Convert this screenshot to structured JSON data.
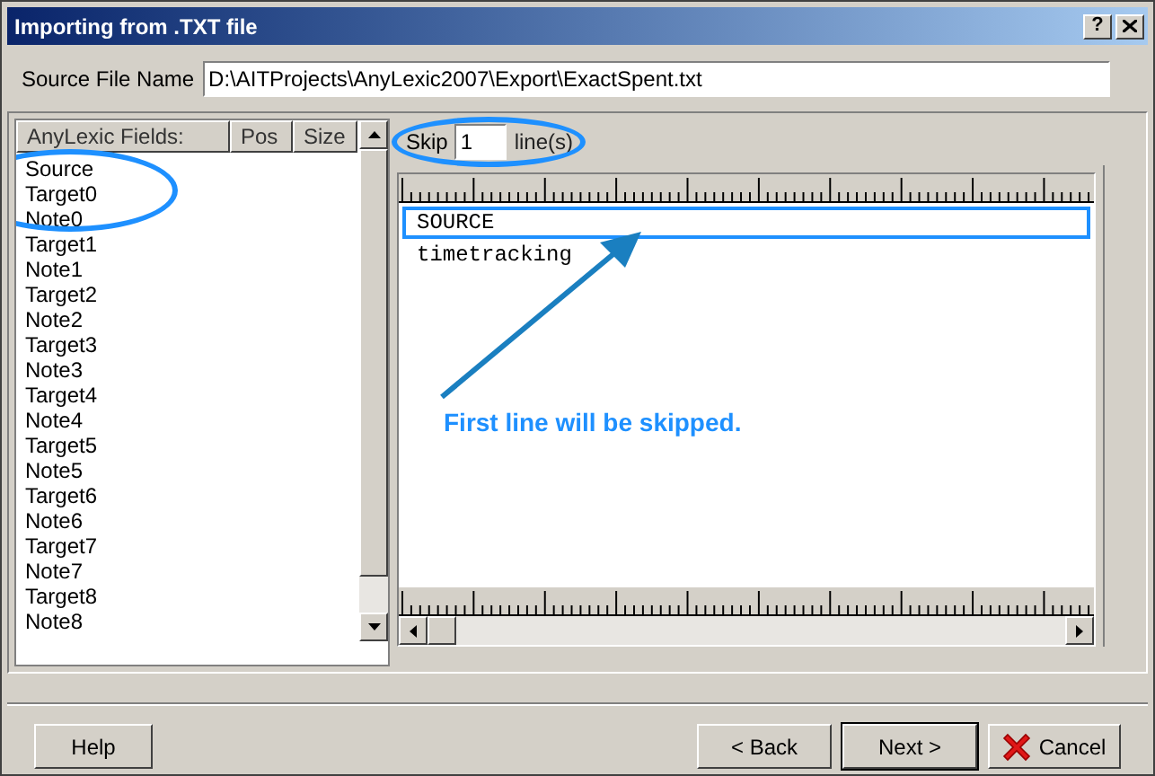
{
  "window": {
    "title": "Importing from .TXT file",
    "help_glyph": "?"
  },
  "source_file": {
    "label": "Source File Name",
    "value": "D:\\AITProjects\\AnyLexic2007\\Export\\ExactSpent.txt"
  },
  "fields": {
    "columns": [
      "AnyLexic Fields:",
      "Pos",
      "Size"
    ],
    "items": [
      {
        "name": "Source",
        "circled": true
      },
      {
        "name": "Target0",
        "circled": true
      },
      {
        "name": "Note0",
        "circled": true
      },
      {
        "name": "Target1",
        "circled": false
      },
      {
        "name": "Note1",
        "circled": false
      },
      {
        "name": "Target2",
        "circled": false
      },
      {
        "name": "Note2",
        "circled": false
      },
      {
        "name": "Target3",
        "circled": false
      },
      {
        "name": "Note3",
        "circled": false
      },
      {
        "name": "Target4",
        "circled": false
      },
      {
        "name": "Note4",
        "circled": false
      },
      {
        "name": "Target5",
        "circled": false
      },
      {
        "name": "Note5",
        "circled": false
      },
      {
        "name": "Target6",
        "circled": false
      },
      {
        "name": "Note6",
        "circled": false
      },
      {
        "name": "Target7",
        "circled": false
      },
      {
        "name": "Note7",
        "circled": false
      },
      {
        "name": "Target8",
        "circled": false
      },
      {
        "name": "Note8",
        "circled": false
      }
    ]
  },
  "skip": {
    "label": "Skip",
    "value": "1",
    "unit": "line(s)",
    "circled": true
  },
  "preview": {
    "lines": [
      {
        "text": "SOURCE",
        "highlighted": true
      },
      {
        "text": "timetracking",
        "highlighted": false
      }
    ],
    "callout": "First line will be skipped."
  },
  "buttons": [
    {
      "label": "Help",
      "kind": "help"
    },
    {
      "label": "< Back",
      "kind": "back"
    },
    {
      "label": "Next >",
      "kind": "default"
    },
    {
      "label": "Cancel",
      "kind": "cancel"
    }
  ]
}
